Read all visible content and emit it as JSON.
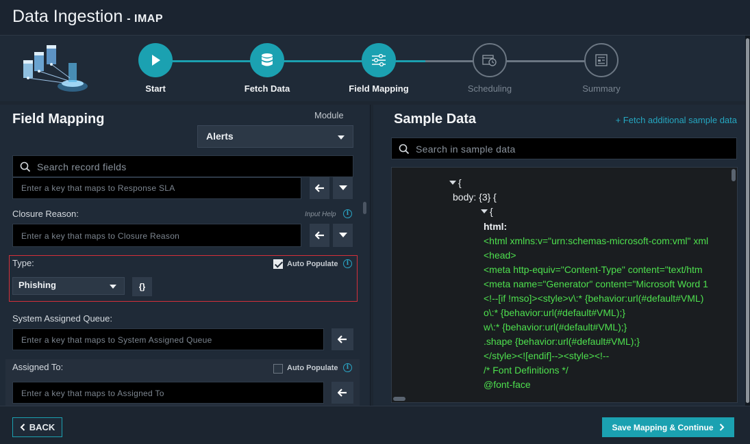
{
  "header": {
    "title": "Data Ingestion",
    "subtitle": "- IMAP"
  },
  "wizard": {
    "steps": [
      {
        "label": "Start",
        "state": "active"
      },
      {
        "label": "Fetch Data",
        "state": "active"
      },
      {
        "label": "Field Mapping",
        "state": "current"
      },
      {
        "label": "Scheduling",
        "state": "inactive"
      },
      {
        "label": "Summary",
        "state": "inactive"
      }
    ]
  },
  "field_mapping": {
    "title": "Field Mapping",
    "module_label": "Module",
    "module_value": "Alerts",
    "search_placeholder": "Search record fields",
    "response_sla_placeholder": "Enter a key that maps to Response SLA",
    "closure_reason": {
      "label": "Closure Reason:",
      "input_help": "Input Help",
      "placeholder": "Enter a key that maps to Closure Reason"
    },
    "type": {
      "label": "Type:",
      "auto_populate": "Auto Populate",
      "auto_populate_checked": true,
      "value": "Phishing",
      "json_btn": "{}"
    },
    "system_assigned_queue": {
      "label": "System Assigned Queue:",
      "placeholder": "Enter a key that maps to System Assigned Queue"
    },
    "assigned_to": {
      "label": "Assigned To:",
      "auto_populate": "Auto Populate",
      "auto_populate_checked": false,
      "placeholder": "Enter a key that maps to Assigned To"
    }
  },
  "sample_data": {
    "title": "Sample Data",
    "fetch_link": "+ Fetch additional sample data",
    "search_placeholder": "Search in sample data",
    "lines": [
      {
        "text": "{",
        "kind": "key",
        "toggle": true
      },
      {
        "text": "body: {3} {",
        "kind": "key",
        "toggle": false
      },
      {
        "text": "{",
        "kind": "key",
        "toggle": true
      },
      {
        "text": "html:",
        "kind": "key",
        "toggle": false
      },
      {
        "text": "<html xmlns:v=\"urn:schemas-microsoft-com:vml\" xml",
        "kind": "val"
      },
      {
        "text": "<head>",
        "kind": "val"
      },
      {
        "text": "<meta http-equiv=\"Content-Type\" content=\"text/htm",
        "kind": "val"
      },
      {
        "text": "<meta name=\"Generator\" content=\"Microsoft Word 1",
        "kind": "val"
      },
      {
        "text": "<!--[if !mso]><style>v\\:* {behavior:url(#default#VML)",
        "kind": "val"
      },
      {
        "text": "o\\:* {behavior:url(#default#VML);}",
        "kind": "val"
      },
      {
        "text": "w\\:* {behavior:url(#default#VML);}",
        "kind": "val"
      },
      {
        "text": ".shape {behavior:url(#default#VML);}",
        "kind": "val"
      },
      {
        "text": "</style><![endif]--><style><!--",
        "kind": "val"
      },
      {
        "text": "/* Font Definitions */",
        "kind": "val"
      },
      {
        "text": "@font-face",
        "kind": "val"
      }
    ]
  },
  "footer": {
    "back_label": "BACK",
    "save_label": "Save Mapping & Continue"
  },
  "colors": {
    "accent": "#1ba1b1",
    "highlight_border": "#d6303a",
    "code_green": "#4ee04e"
  }
}
